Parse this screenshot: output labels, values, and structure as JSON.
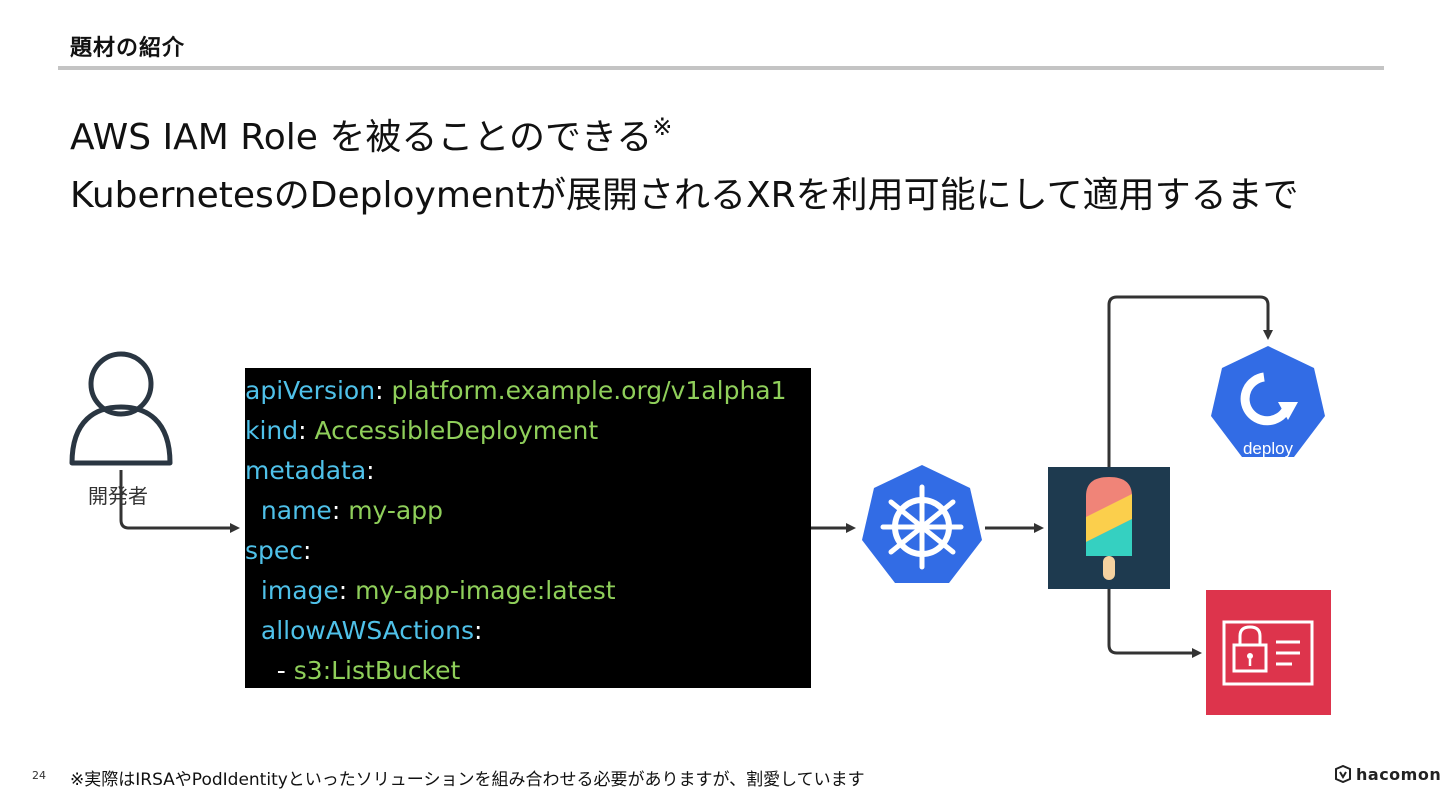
{
  "header": {
    "section_title": "題材の紹介"
  },
  "headline": {
    "line1": "AWS IAM Role を被ることのできる",
    "line1_mark": "※",
    "line2": "KubernetesのDeploymentが展開されるXRを利用可能にして適用するまで"
  },
  "diagram": {
    "developer_label": "開発者",
    "manifest_lines": [
      {
        "indent": "",
        "key": "apiVersion",
        "sep": ": ",
        "value": "platform.example.org/v1alpha1"
      },
      {
        "indent": "",
        "key": "kind",
        "sep": ": ",
        "value": "AccessibleDeployment"
      },
      {
        "indent": "",
        "key": "metadata",
        "sep": ":",
        "value": ""
      },
      {
        "indent": "  ",
        "key": "name",
        "sep": ": ",
        "value": "my-app"
      },
      {
        "indent": "",
        "key": "spec",
        "sep": ":",
        "value": ""
      },
      {
        "indent": "  ",
        "key": "image",
        "sep": ": ",
        "value": "my-app-image:latest"
      },
      {
        "indent": "  ",
        "key": "allowAWSActions",
        "sep": ":",
        "value": ""
      },
      {
        "indent": "    - ",
        "key": "",
        "sep": "",
        "value": "s3:ListBucket"
      }
    ],
    "deploy_icon_label": "deploy",
    "icons": {
      "kubernetes": "kubernetes-helm-icon",
      "crossplane": "crossplane-popsicle-icon",
      "deploy": "kubernetes-deploy-icon",
      "iam": "aws-iam-role-icon",
      "person": "person-icon"
    },
    "colors": {
      "kubernetes_blue": "#326ce5",
      "crossplane_bg": "#1e3a4f",
      "iam_red": "#dd344c",
      "code_key": "#4fc1e9",
      "code_value": "#8fcf5a",
      "arrow": "#333333"
    }
  },
  "footer": {
    "page_number": "24",
    "footnote": "※実際はIRSAやPodIdentityといったソリューションを組み合わせる必要がありますが、割愛しています",
    "brand": "hacomono"
  }
}
